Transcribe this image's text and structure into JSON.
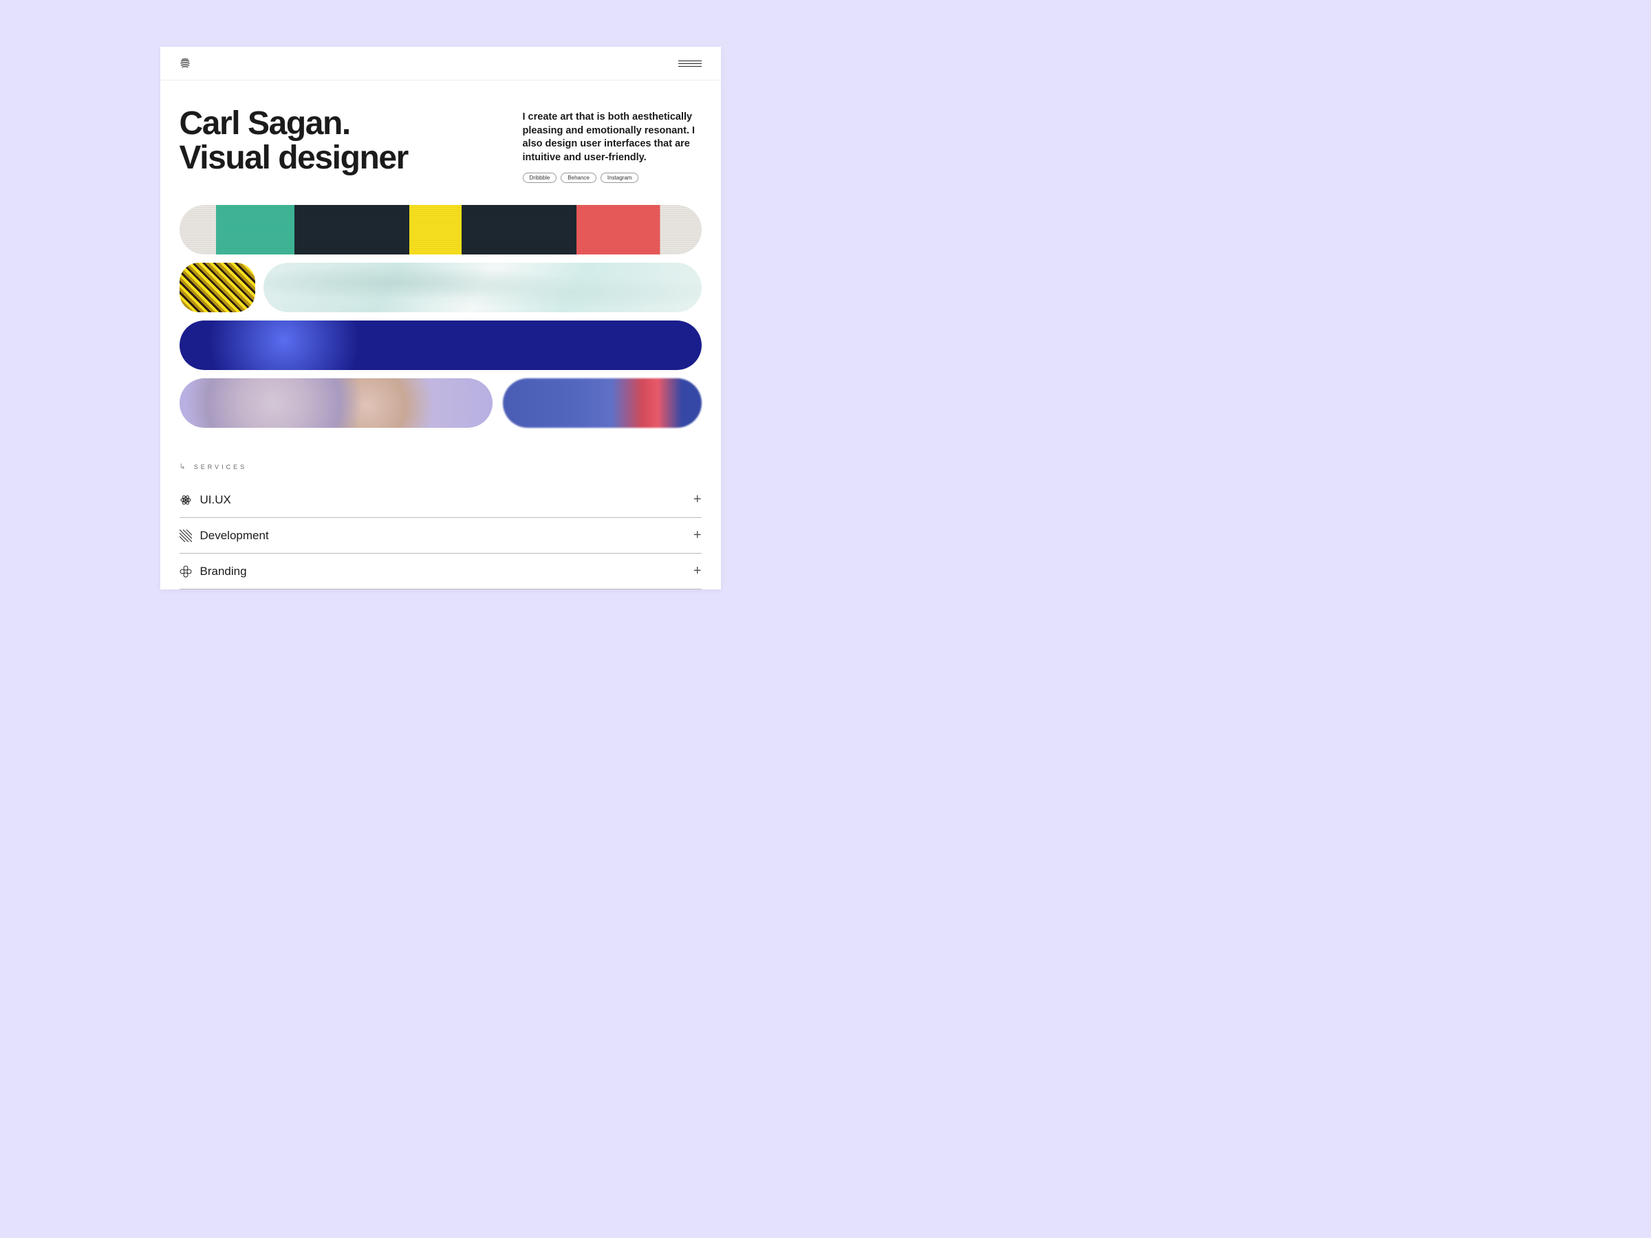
{
  "hero": {
    "title_line1": "Carl Sagan.",
    "title_line2": "Visual designer",
    "description": "I create art that is both aesthetically pleasing and emotionally resonant. I also design user interfaces that are intuitive and user-friendly."
  },
  "social": [
    {
      "label": "Dribbble"
    },
    {
      "label": "Behance"
    },
    {
      "label": "Instagram"
    }
  ],
  "services_heading": "SERVICES",
  "services": [
    {
      "title": "UI.UX"
    },
    {
      "title": "Development"
    },
    {
      "title": "Branding"
    }
  ]
}
